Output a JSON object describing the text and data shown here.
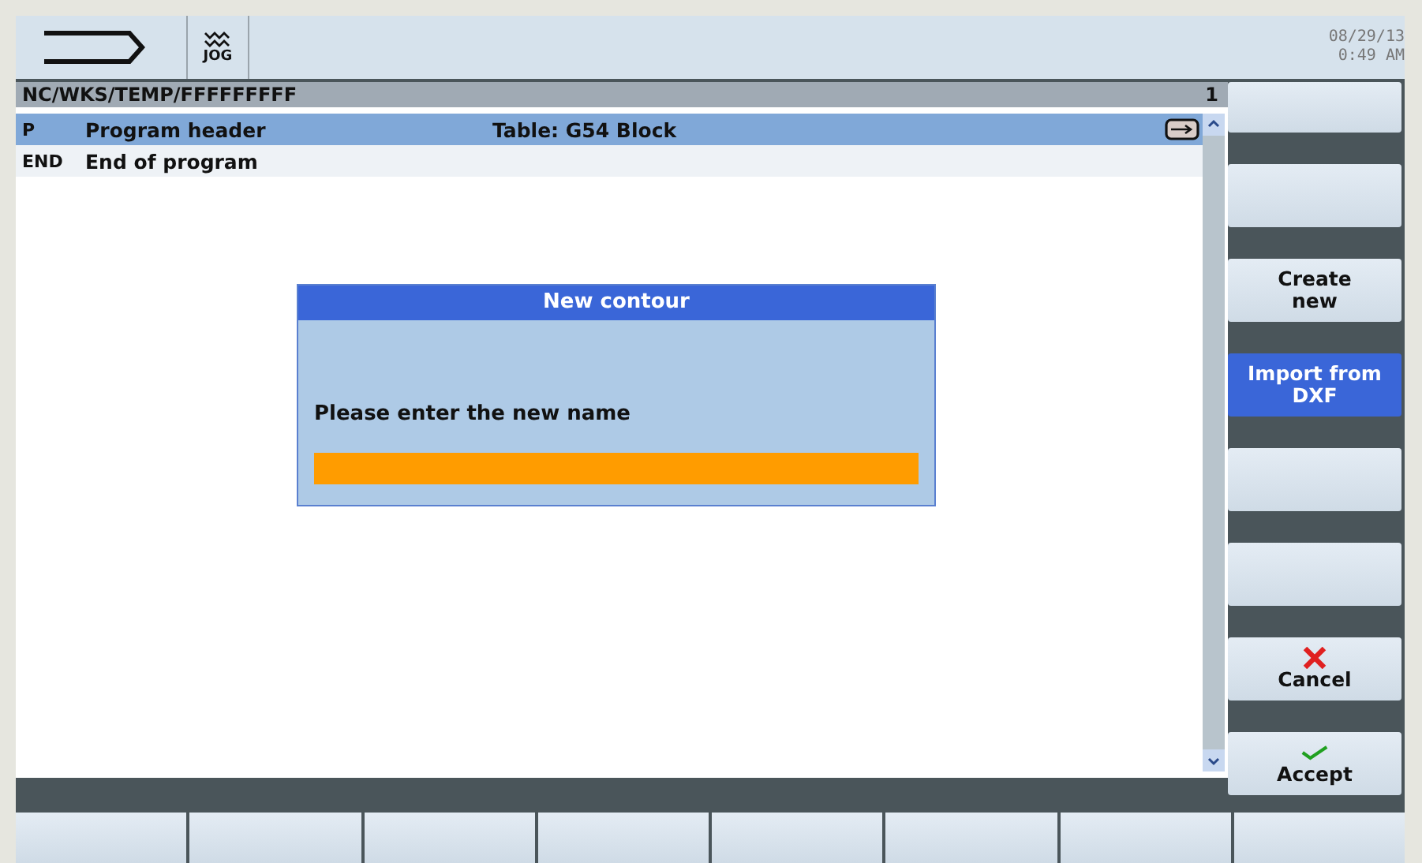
{
  "header": {
    "mode": "JOG",
    "date": "08/29/13",
    "time": "0:49 AM"
  },
  "path_bar": {
    "path": "NC/WKS/TEMP/FFFFFFFFF",
    "channel": "1"
  },
  "program_rows": [
    {
      "code": "P",
      "text": "Program header",
      "detail": "Table: G54 Block",
      "selected": true
    },
    {
      "code": "END",
      "text": "End of program",
      "selected": false
    }
  ],
  "dialog": {
    "title": "New contour",
    "prompt": "Please enter the new name"
  },
  "vertical_softkeys": [
    {
      "kind": "plain",
      "selected": false
    },
    {
      "kind": "plain",
      "selected": false
    },
    {
      "kind": "plain",
      "label_lines": [
        "Create",
        "new"
      ],
      "selected": false
    },
    {
      "kind": "plain",
      "label_lines": [
        "Import from",
        "DXF"
      ],
      "selected": true
    },
    {
      "kind": "plain",
      "selected": false
    },
    {
      "kind": "plain",
      "selected": false
    },
    {
      "kind": "cancel",
      "label_lines": [
        "Cancel"
      ],
      "selected": false
    },
    {
      "kind": "accept",
      "label_lines": [
        "Accept"
      ],
      "selected": false
    }
  ],
  "horizontal_softkeys": [
    {
      "selected": false
    },
    {
      "selected": false
    },
    {
      "selected": false
    },
    {
      "selected": false
    },
    {
      "selected": false
    },
    {
      "selected": false
    },
    {
      "selected": false
    },
    {
      "selected": false
    }
  ]
}
